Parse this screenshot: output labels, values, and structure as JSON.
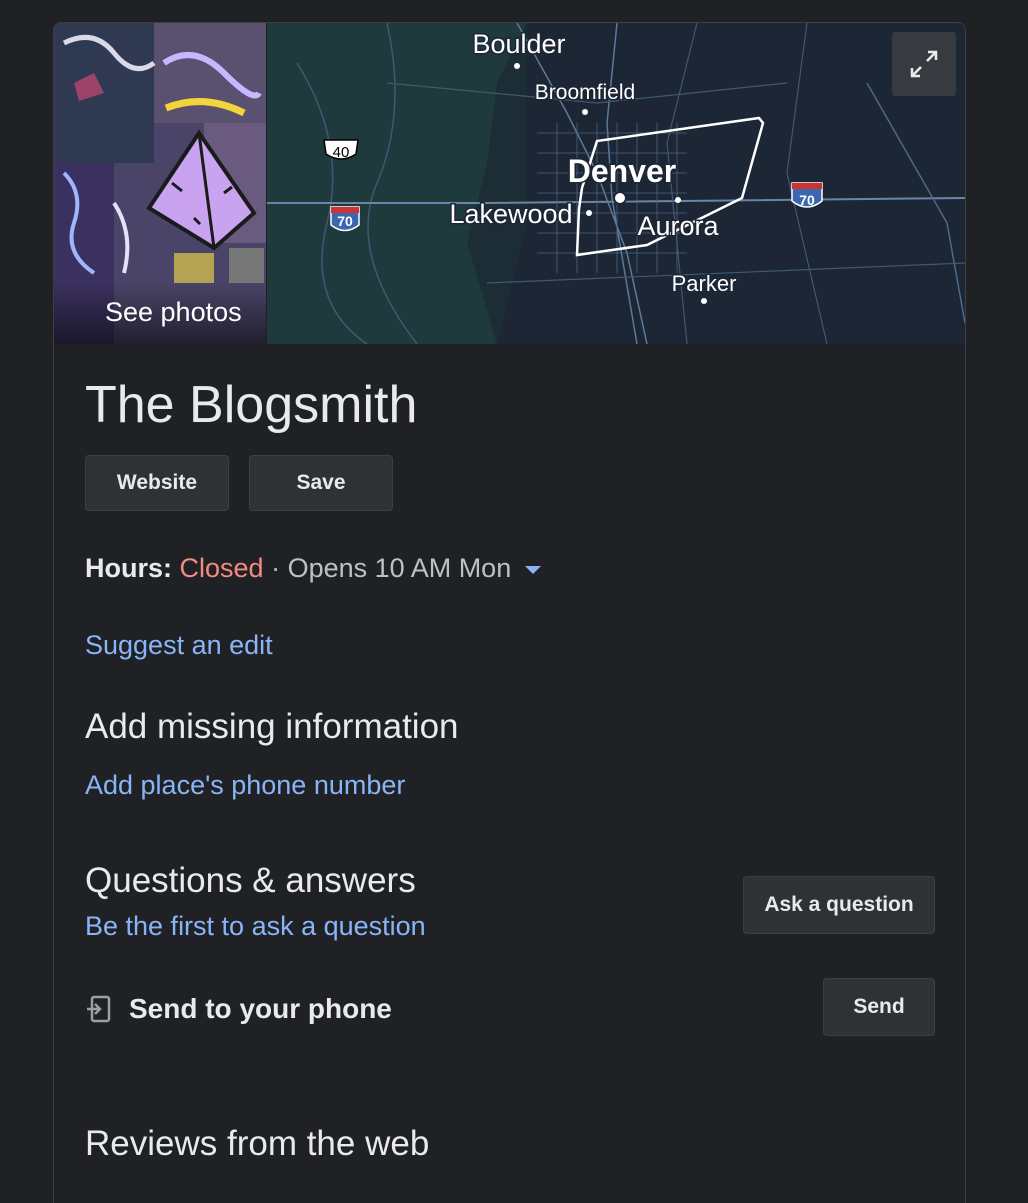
{
  "hero": {
    "see_photos_label": "See photos",
    "map": {
      "cities": {
        "boulder": "Boulder",
        "broomfield": "Broomfield",
        "denver": "Denver",
        "lakewood": "Lakewood",
        "aurora": "Aurora",
        "parker": "Parker"
      },
      "highway_shields": {
        "us40": "40",
        "i70_west": "70",
        "i70_east": "70"
      }
    },
    "expand_icon": "expand-icon"
  },
  "place": {
    "name": "The Blogsmith"
  },
  "actions": {
    "website_label": "Website",
    "save_label": "Save"
  },
  "hours": {
    "label": "Hours:",
    "status": "Closed",
    "separator": "·",
    "next_open": "Opens 10 AM Mon"
  },
  "suggest_edit_label": "Suggest an edit",
  "missing_info": {
    "heading": "Add missing information",
    "add_phone_label": "Add place's phone number"
  },
  "qa": {
    "heading": "Questions & answers",
    "first_question_label": "Be the first to ask a question",
    "ask_button_label": "Ask a question"
  },
  "send_to_phone": {
    "icon": "send-to-device-icon",
    "label": "Send to your phone",
    "button_label": "Send"
  },
  "reviews": {
    "heading": "Reviews from the web"
  },
  "colors": {
    "background": "#202124",
    "text": "#e8eaed",
    "link": "#8ab4f8",
    "closed": "#f28b82",
    "button_bg": "#303134"
  }
}
